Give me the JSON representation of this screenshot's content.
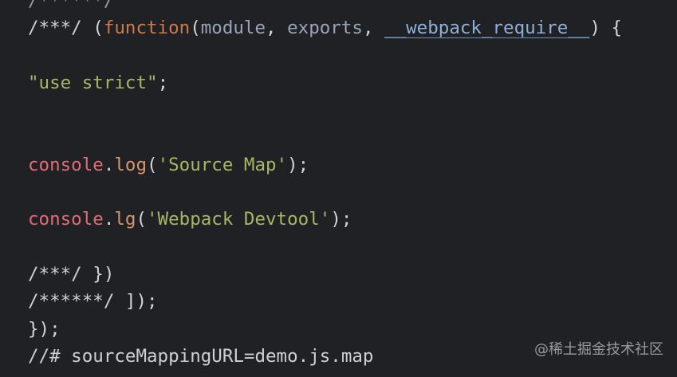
{
  "editor": {
    "lines": [
      {
        "comment": "/******/"
      },
      {
        "comment": "/***/",
        "open_paren": "(",
        "keyword": "function",
        "open_paren2": "(",
        "param1": "module",
        "comma1": ", ",
        "param2": "exports",
        "comma2": ", ",
        "param3": "__webpack_require__",
        "close": ") {"
      },
      {},
      {
        "string": "\"use strict\"",
        "end": ";"
      },
      {},
      {},
      {
        "object": "console",
        "dot": ".",
        "method": "log",
        "open": "(",
        "string": "'Source Map'",
        "close": ");"
      },
      {},
      {
        "object": "console",
        "dot": ".",
        "method": "lg",
        "open": "(",
        "string": "'Webpack Devtool'",
        "close": ");"
      },
      {},
      {
        "comment": "/***/",
        "close": "})"
      },
      {
        "comment": "/******/",
        "close": "]);"
      },
      {
        "text": "});"
      },
      {
        "text": "//# sourceMappingURL=demo.js.map"
      }
    ]
  },
  "watermark": "@稀土掘金技术社区",
  "colors": {
    "background": "#202124",
    "keyword": "#cd7a4a",
    "string": "#a9b565",
    "identifier": "#e06c75",
    "parameter": "#9aa4b8"
  }
}
